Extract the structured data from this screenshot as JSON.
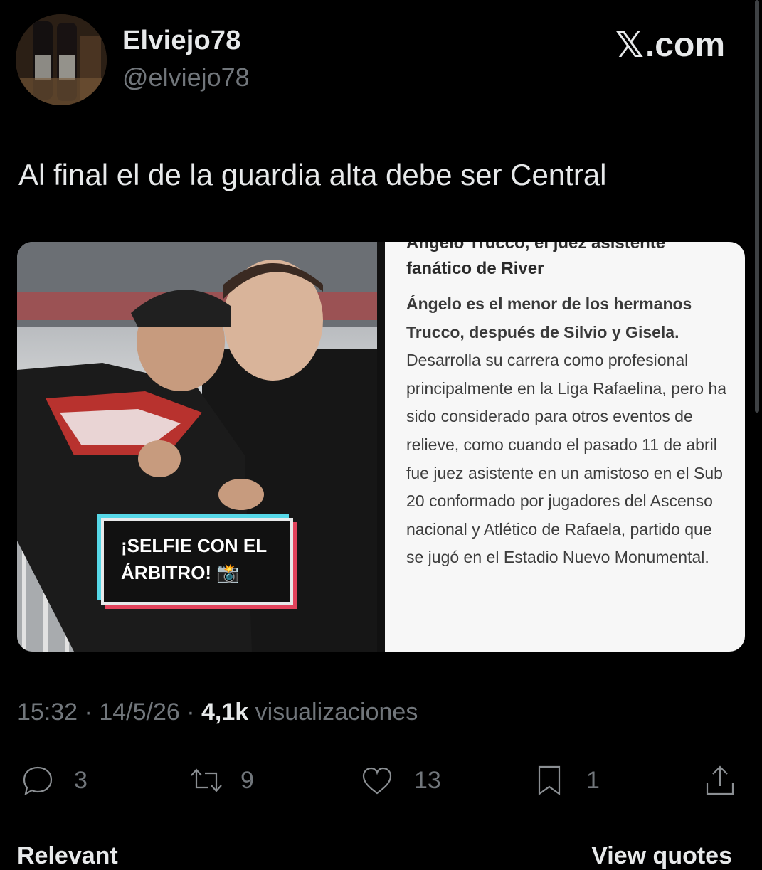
{
  "author": {
    "display_name": "Elviejo78",
    "handle": "@elviejo78"
  },
  "brand": {
    "label": ".com",
    "x_glyph": "𝕏"
  },
  "tweet": {
    "text": "Al final el de la guardia alta debe ser Central"
  },
  "media": {
    "photo_overlay_line1": "¡SELFIE CON EL",
    "photo_overlay_line2": "ÁRBITRO! 📸",
    "article": {
      "cut_title": "Ángelo Trucco, el juez asistente",
      "title": "fanático de River",
      "lead": "Ángelo es el menor de los hermanos Trucco, después de Silvio y Gisela.",
      "body": "Desarrolla su carrera como profesional principalmente en la Liga Rafaelina, pero ha sido considerado para otros eventos de relieve, como cuando el pasado 11 de abril fue juez asistente en un amistoso en el Sub 20 conformado por jugadores del Ascenso nacional y Atlético de Rafaela, partido que se jugó en el Estadio Nuevo Monumental."
    }
  },
  "meta": {
    "time": "15:32",
    "date": "14/5/26",
    "separator": "·",
    "views_count": "4,1k",
    "views_label": "visualizaciones"
  },
  "actions": {
    "replies": "3",
    "reposts": "9",
    "likes": "13",
    "bookmarks": "1"
  },
  "bottom_partial": {
    "left": "Relevant",
    "right": "View quotes"
  },
  "colors": {
    "background": "#000000",
    "primary_text": "#e7e9ea",
    "secondary_text": "#71767b",
    "overlay_cyan": "#56d8e8",
    "overlay_red": "#e2435c"
  }
}
